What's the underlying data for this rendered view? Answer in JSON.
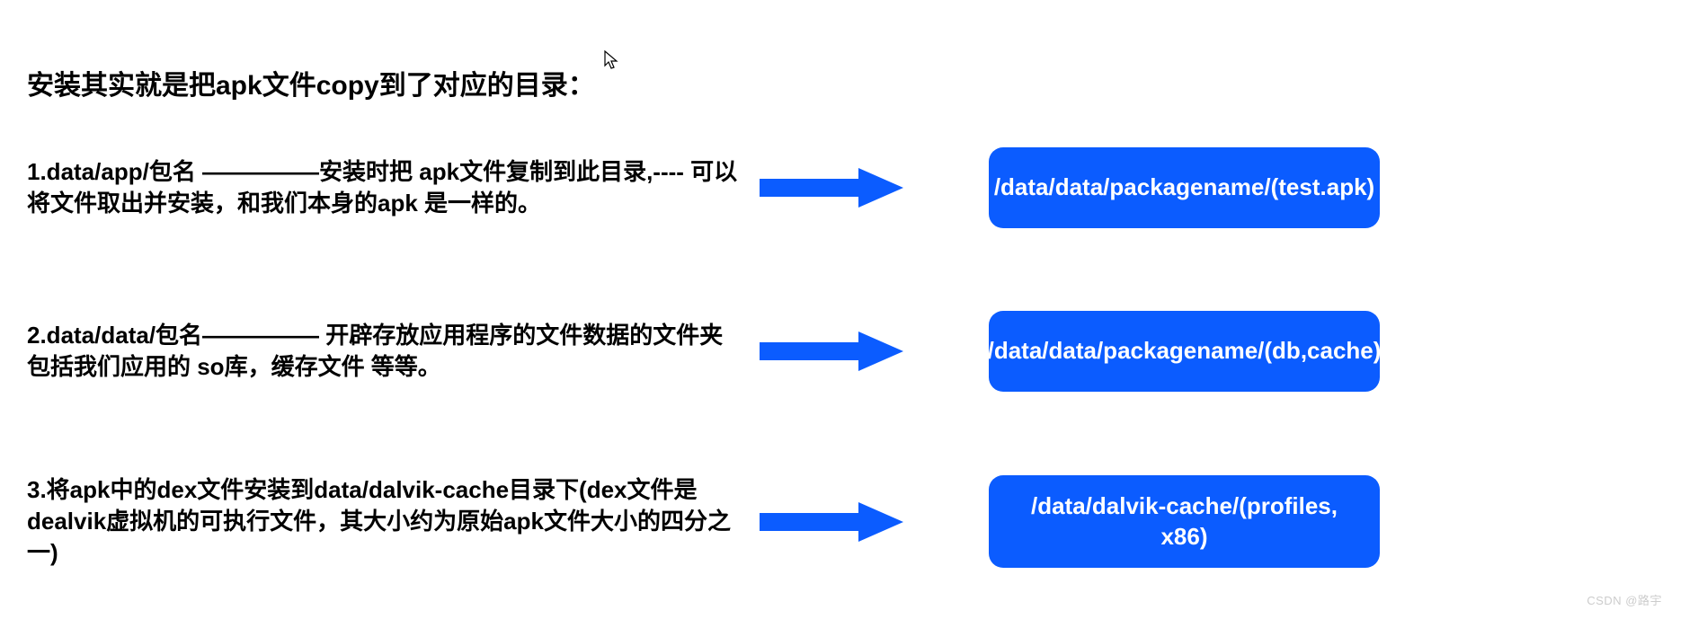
{
  "heading": "安装其实就是把apk文件copy到了对应的目录：",
  "rows": [
    {
      "text": "1.data/app/包名 —————安装时把 apk文件复制到此目录,---- 可以将文件取出并安装，和我们本身的apk 是一样的。",
      "box": "/data/data/packagename/(test.apk)"
    },
    {
      "text": "2.data/data/包名————— 开辟存放应用程序的文件数据的文件夹包括我们应用的 so库，缓存文件 等等。",
      "box": "/data/data/packagename/(db,cache)"
    },
    {
      "text": "3.将apk中的dex文件安装到data/dalvik-cache目录下(dex文件是dealvik虚拟机的可执行文件，其大小约为原始apk文件大小的四分之一)",
      "box": "/data/dalvik-cache/(profiles, x86)"
    }
  ],
  "colors": {
    "primary": "#0b5cff"
  },
  "watermark": "CSDN @路宇"
}
